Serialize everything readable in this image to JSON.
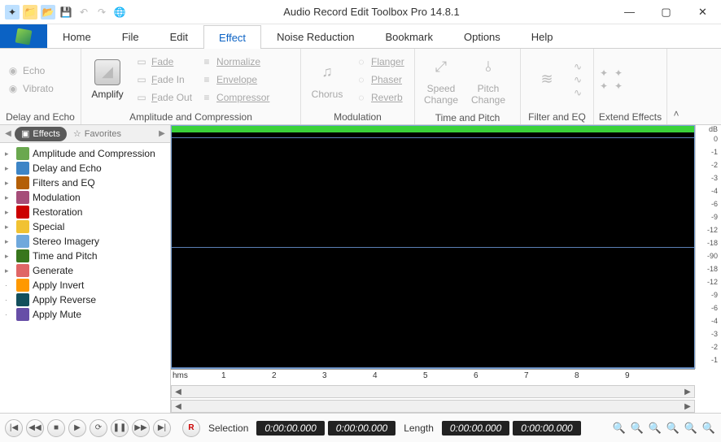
{
  "title": "Audio Record Edit Toolbox Pro 14.8.1",
  "tabs": [
    "Home",
    "File",
    "Edit",
    "Effect",
    "Noise Reduction",
    "Bookmark",
    "Options",
    "Help"
  ],
  "active_tab": "Effect",
  "ribbon": {
    "groups": [
      {
        "label": "Delay and Echo",
        "items": [
          {
            "type": "big",
            "text": "Echo"
          },
          {
            "type": "big",
            "text": "Vibrato"
          }
        ]
      },
      {
        "label": "Amplitude and Compression",
        "big": "Amplify",
        "col": [
          "Fade",
          "Fade In",
          "Fade Out"
        ],
        "col2": [
          "Normalize",
          "Envelope",
          "Compressor"
        ]
      },
      {
        "label": "Modulation",
        "big": "Chorus",
        "col": [
          "Flanger",
          "Phaser",
          "Reverb"
        ]
      },
      {
        "label": "Time and Pitch",
        "bigs": [
          "Speed Change",
          "Pitch Change"
        ]
      },
      {
        "label": "Filter and EQ"
      },
      {
        "label": "Extend Effects"
      }
    ]
  },
  "side": {
    "tabs": {
      "effects": "Effects",
      "favorites": "Favorites"
    },
    "tree": [
      {
        "exp": true,
        "icon": "#6aa84f",
        "label": "Amplitude and Compression"
      },
      {
        "exp": true,
        "icon": "#3d85c6",
        "label": "Delay and Echo"
      },
      {
        "exp": true,
        "icon": "#b45f06",
        "label": "Filters and EQ"
      },
      {
        "exp": true,
        "icon": "#a64d79",
        "label": "Modulation"
      },
      {
        "exp": true,
        "icon": "#cc0000",
        "label": "Restoration"
      },
      {
        "exp": true,
        "icon": "#f1c232",
        "label": "Special"
      },
      {
        "exp": true,
        "icon": "#6fa8dc",
        "label": "Stereo Imagery"
      },
      {
        "exp": true,
        "icon": "#38761d",
        "label": "Time and Pitch"
      },
      {
        "exp": true,
        "icon": "#e06666",
        "label": "Generate"
      },
      {
        "exp": false,
        "icon": "#ff9900",
        "label": "Apply Invert"
      },
      {
        "exp": false,
        "icon": "#134f5c",
        "label": "Apply Reverse"
      },
      {
        "exp": false,
        "icon": "#674ea7",
        "label": "Apply Mute"
      }
    ]
  },
  "db_header": "dB",
  "db_left": [
    "0",
    "-1",
    "-2",
    "-3",
    "-4",
    "-6",
    "-9",
    "-12",
    "-18"
  ],
  "db_right": [
    "-90",
    "-18",
    "-12",
    "-9",
    "-6",
    "-4",
    "-3",
    "-2",
    "-1"
  ],
  "ruler": {
    "unit": "hms",
    "ticks": [
      "1",
      "2",
      "3",
      "4",
      "5",
      "6",
      "7",
      "8",
      "9"
    ]
  },
  "status": {
    "selection_label": "Selection",
    "sel_from": "0:00:00.000",
    "sel_to": "0:00:00.000",
    "length_label": "Length",
    "len_from": "0:00:00.000",
    "len_to": "0:00:00.000"
  }
}
